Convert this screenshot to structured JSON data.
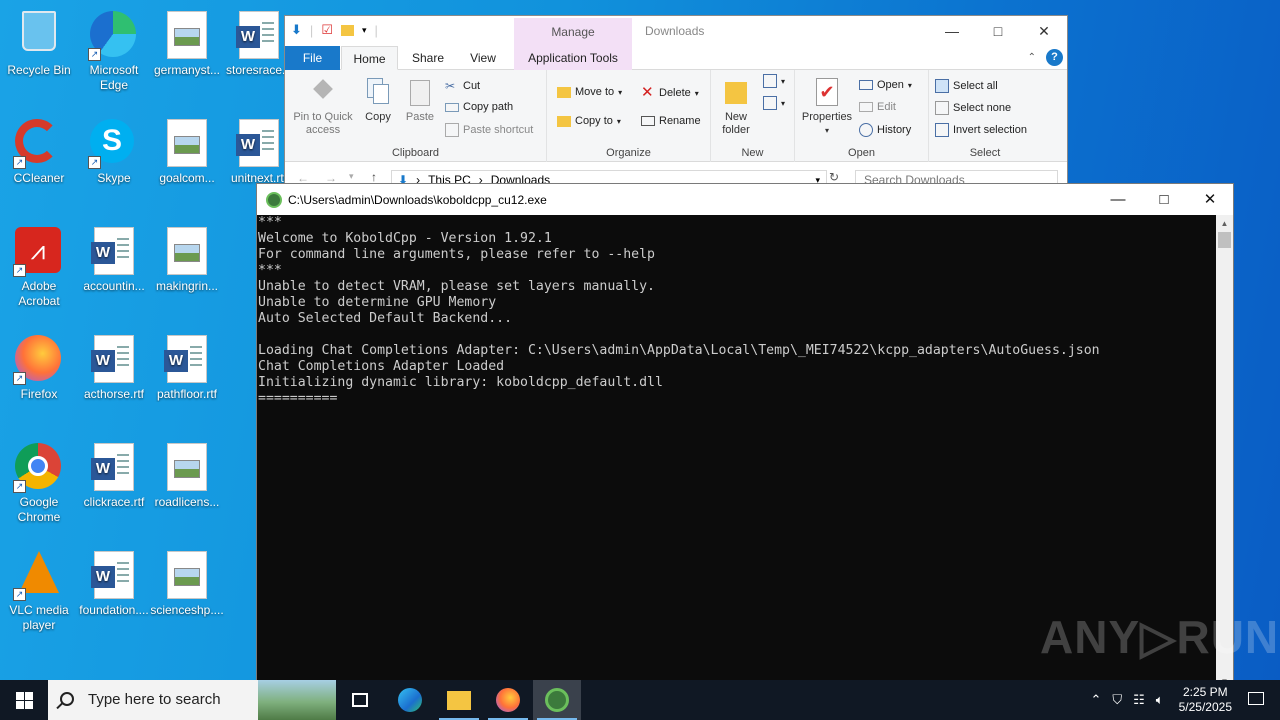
{
  "desktop": {
    "icons": [
      {
        "label": "Recycle Bin",
        "icon": "recycle-bin-icon"
      },
      {
        "label": "Microsoft Edge",
        "icon": "edge-icon"
      },
      {
        "label": "germanyst...",
        "icon": "image-file-icon"
      },
      {
        "label": "storesrace...",
        "icon": "word-doc-icon"
      },
      {
        "label": "CCleaner",
        "icon": "ccleaner-icon"
      },
      {
        "label": "Skype",
        "icon": "skype-icon"
      },
      {
        "label": "goalcom...",
        "icon": "image-file-icon"
      },
      {
        "label": "unitnext.rtf",
        "icon": "word-doc-icon"
      },
      {
        "label": "Adobe Acrobat",
        "icon": "acrobat-icon"
      },
      {
        "label": "accountin...",
        "icon": "word-doc-icon"
      },
      {
        "label": "makingrin...",
        "icon": "image-file-icon"
      },
      {
        "label": "Firefox",
        "icon": "firefox-icon"
      },
      {
        "label": "acthorse.rtf",
        "icon": "word-doc-icon"
      },
      {
        "label": "pathfloor.rtf",
        "icon": "word-doc-icon"
      },
      {
        "label": "Google Chrome",
        "icon": "chrome-icon"
      },
      {
        "label": "clickrace.rtf",
        "icon": "word-doc-icon"
      },
      {
        "label": "roadlicens...",
        "icon": "image-file-icon"
      },
      {
        "label": "VLC media player",
        "icon": "vlc-icon"
      },
      {
        "label": "foundation....",
        "icon": "word-doc-icon"
      },
      {
        "label": "scienceshp....",
        "icon": "image-file-icon"
      }
    ]
  },
  "explorer": {
    "title": "Downloads",
    "manage_label": "Manage",
    "tabs": {
      "file": "File",
      "home": "Home",
      "share": "Share",
      "view": "View",
      "app_tools": "Application Tools"
    },
    "clipboard": {
      "pin": "Pin to Quick access",
      "copy": "Copy",
      "paste": "Paste",
      "cut": "Cut",
      "copy_path": "Copy path",
      "paste_shortcut": "Paste shortcut",
      "group": "Clipboard"
    },
    "organize": {
      "move_to": "Move to",
      "copy_to": "Copy to",
      "delete": "Delete",
      "rename": "Rename",
      "group": "Organize"
    },
    "new": {
      "new_folder": "New folder",
      "group": "New"
    },
    "open": {
      "properties": "Properties",
      "open": "Open",
      "edit": "Edit",
      "history": "History",
      "group": "Open"
    },
    "select": {
      "select_all": "Select all",
      "select_none": "Select none",
      "invert": "Invert selection",
      "group": "Select"
    },
    "address": {
      "crumb1": "This PC",
      "crumb2": "Downloads"
    },
    "search_placeholder": "Search Downloads"
  },
  "console": {
    "title": "C:\\Users\\admin\\Downloads\\koboldcpp_cu12.exe",
    "lines": [
      "***",
      "Welcome to KoboldCpp - Version 1.92.1",
      "For command line arguments, please refer to --help",
      "***",
      "Unable to detect VRAM, please set layers manually.",
      "Unable to determine GPU Memory",
      "Auto Selected Default Backend...",
      "",
      "Loading Chat Completions Adapter: C:\\Users\\admin\\AppData\\Local\\Temp\\_MEI74522\\kcpp_adapters\\AutoGuess.json",
      "Chat Completions Adapter Loaded",
      "Initializing dynamic library: koboldcpp_default.dll",
      "=========="
    ]
  },
  "watermark": "ANY▷RUN",
  "taskbar": {
    "search_placeholder": "Type here to search",
    "time": "2:25 PM",
    "date": "5/25/2025"
  }
}
